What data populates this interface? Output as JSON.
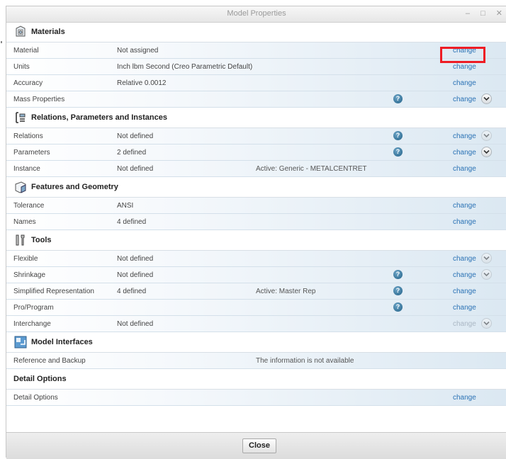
{
  "window": {
    "title": "Model Properties",
    "controls": "– □ ✕",
    "close_label": "Close"
  },
  "sections": [
    {
      "title": "Materials",
      "icon": "materials-icon",
      "rows": [
        {
          "label": "Material",
          "value": "Not assigned",
          "extra": "",
          "help": false,
          "change": "change",
          "change_enabled": true,
          "expand": "none"
        },
        {
          "label": "Units",
          "value": "Inch lbm Second (Creo Parametric Default)",
          "extra": "",
          "help": false,
          "change": "change",
          "change_enabled": true,
          "expand": "none"
        },
        {
          "label": "Accuracy",
          "value": "Relative 0.0012",
          "extra": "",
          "help": false,
          "change": "change",
          "change_enabled": true,
          "expand": "none"
        },
        {
          "label": "Mass Properties",
          "value": "",
          "extra": "",
          "help": true,
          "change": "change",
          "change_enabled": true,
          "expand": "active"
        }
      ]
    },
    {
      "title": "Relations, Parameters and Instances",
      "icon": "relations-icon",
      "rows": [
        {
          "label": "Relations",
          "value": "Not defined",
          "extra": "",
          "help": true,
          "change": "change",
          "change_enabled": true,
          "expand": "faded"
        },
        {
          "label": "Parameters",
          "value": "2 defined",
          "extra": "",
          "help": true,
          "change": "change",
          "change_enabled": true,
          "expand": "active"
        },
        {
          "label": "Instance",
          "value": "Not defined",
          "extra": "Active: Generic - METALCENTRET",
          "help": false,
          "change": "change",
          "change_enabled": true,
          "expand": "none"
        }
      ]
    },
    {
      "title": "Features and Geometry",
      "icon": "features-icon",
      "rows": [
        {
          "label": "Tolerance",
          "value": "ANSI",
          "extra": "",
          "help": false,
          "change": "change",
          "change_enabled": true,
          "expand": "none"
        },
        {
          "label": "Names",
          "value": "4 defined",
          "extra": "",
          "help": false,
          "change": "change",
          "change_enabled": true,
          "expand": "none"
        }
      ]
    },
    {
      "title": "Tools",
      "icon": "tools-icon",
      "rows": [
        {
          "label": "Flexible",
          "value": "Not defined",
          "extra": "",
          "help": false,
          "change": "change",
          "change_enabled": true,
          "expand": "faded"
        },
        {
          "label": "Shrinkage",
          "value": "Not defined",
          "extra": "",
          "help": true,
          "change": "change",
          "change_enabled": true,
          "expand": "faded"
        },
        {
          "label": "Simplified Representation",
          "value": "4 defined",
          "extra": "Active: Master Rep",
          "help": true,
          "change": "change",
          "change_enabled": true,
          "expand": "none"
        },
        {
          "label": "Pro/Program",
          "value": "",
          "extra": "",
          "help": true,
          "change": "change",
          "change_enabled": true,
          "expand": "none"
        },
        {
          "label": "Interchange",
          "value": "Not defined",
          "extra": "",
          "help": false,
          "change": "change",
          "change_enabled": false,
          "expand": "faded"
        }
      ]
    },
    {
      "title": "Model Interfaces",
      "icon": "model-interfaces-icon",
      "rows": [
        {
          "label": "Reference and Backup",
          "value": "",
          "extra": "The information is not available",
          "help": false,
          "change": "",
          "change_enabled": false,
          "expand": "none"
        }
      ]
    },
    {
      "title": "Detail Options",
      "icon": "",
      "rows": [
        {
          "label": "Detail Options",
          "value": "",
          "extra": "",
          "help": false,
          "change": "change",
          "change_enabled": true,
          "expand": "none"
        }
      ]
    }
  ],
  "colors": {
    "link": "#2a72b5",
    "highlight": "#ee1c24",
    "row_gradient_end": "#dbe8f2"
  }
}
